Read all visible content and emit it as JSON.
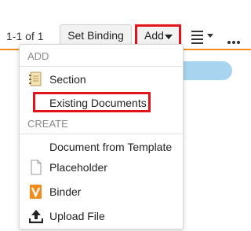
{
  "toolbar": {
    "pager_text": "1-1 of 1",
    "set_binding_label": "Set Binding",
    "add_label": "Add"
  },
  "menu": {
    "add_header": "ADD",
    "create_header": "CREATE",
    "items": [
      {
        "label": "Section",
        "icon": "section-icon"
      },
      {
        "label": "Existing Documents",
        "icon": ""
      },
      {
        "label": "Document from Template",
        "icon": ""
      },
      {
        "label": "Placeholder",
        "icon": "placeholder-document-icon"
      },
      {
        "label": "Binder",
        "icon": "binder-icon"
      },
      {
        "label": "Upload File",
        "icon": "upload-icon"
      }
    ]
  },
  "colors": {
    "accent": "#f28c1c",
    "highlight_box": "#e0151c",
    "binder_orange": "#f28c1c"
  }
}
